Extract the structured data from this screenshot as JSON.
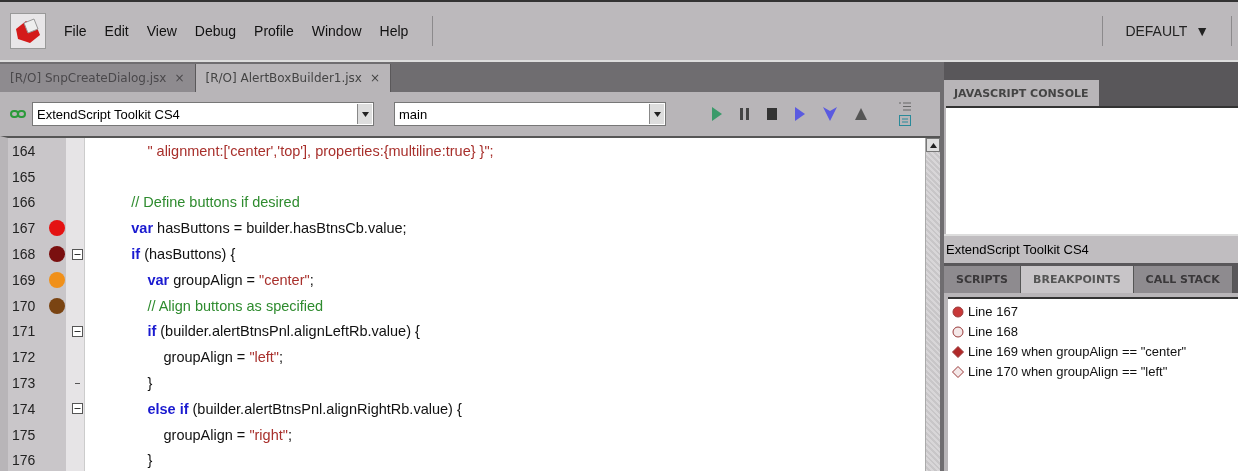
{
  "menu_bar": {
    "items": [
      "File",
      "Edit",
      "View",
      "Debug",
      "Profile",
      "Window",
      "Help"
    ],
    "workspace": "DEFAULT",
    "workspace_caret": "▼"
  },
  "document_tabs": [
    {
      "label": "[R/O] SnpCreateDialog.jsx",
      "close": "×",
      "selected": false
    },
    {
      "label": "[R/O] AlertBoxBuilder1.jsx",
      "close": "×",
      "selected": true
    }
  ],
  "toolbar": {
    "target": "ExtendScript Toolkit CS4",
    "function": "main"
  },
  "editor": {
    "lines": [
      {
        "number": "164",
        "tokens": [
          {
            "kind": "string",
            "text": "              \" alignment:['center','top'], properties:{multiline:true} }\";"
          }
        ]
      },
      {
        "number": "165"
      },
      {
        "number": "166",
        "tokens": [
          {
            "kind": "comment",
            "text": "          // Define buttons if desired"
          }
        ]
      },
      {
        "number": "167",
        "breakpoint": {
          "conditional": false,
          "enabled": true
        },
        "tokens": [
          {
            "kind": "keyword",
            "text": "          var"
          },
          {
            "kind": "plain",
            "text": " hasButtons = builder.hasBtnsCb.value;"
          }
        ]
      },
      {
        "number": "168",
        "breakpoint": {
          "conditional": false,
          "enabled": false
        },
        "collapse_box": true,
        "tokens": [
          {
            "kind": "keyword",
            "text": "          if"
          },
          {
            "kind": "plain",
            "text": " (hasButtons) {"
          }
        ]
      },
      {
        "number": "169",
        "breakpoint": {
          "conditional": true,
          "enabled": true
        },
        "tokens": [
          {
            "kind": "keyword",
            "text": "              var"
          },
          {
            "kind": "plain",
            "text": " groupAlign = "
          },
          {
            "kind": "string",
            "text": "\"center\""
          },
          {
            "kind": "plain",
            "text": ";"
          }
        ]
      },
      {
        "number": "170",
        "breakpoint": {
          "conditional": true,
          "enabled": false
        },
        "tokens": [
          {
            "kind": "comment",
            "text": "              // Align buttons as specified"
          }
        ]
      },
      {
        "number": "171",
        "collapse_box": true,
        "tokens": [
          {
            "kind": "keyword",
            "text": "              if"
          },
          {
            "kind": "plain",
            "text": " (builder.alertBtnsPnl.alignLeftRb.value) {"
          }
        ]
      },
      {
        "number": "172",
        "tokens": [
          {
            "kind": "plain",
            "text": "                  groupAlign = "
          },
          {
            "kind": "string",
            "text": "\"left\""
          },
          {
            "kind": "plain",
            "text": ";"
          }
        ]
      },
      {
        "number": "173",
        "block_end": true,
        "tokens": [
          {
            "kind": "plain",
            "text": "              }"
          }
        ]
      },
      {
        "number": "174",
        "collapse_box": true,
        "tokens": [
          {
            "kind": "keyword",
            "text": "              else if"
          },
          {
            "kind": "plain",
            "text": " (builder.alertBtnsPnl.alignRightRb.value) {"
          }
        ]
      },
      {
        "number": "175",
        "tokens": [
          {
            "kind": "plain",
            "text": "                  groupAlign = "
          },
          {
            "kind": "string",
            "text": "\"right\""
          },
          {
            "kind": "plain",
            "text": ";"
          }
        ]
      },
      {
        "number": "176",
        "tokens": [
          {
            "kind": "plain",
            "text": "              }"
          }
        ]
      }
    ]
  },
  "console_panel": {
    "tab": "JAVASCRIPT CONSOLE",
    "target": "ExtendScript Toolkit CS4"
  },
  "debug_panel": {
    "tabs": [
      {
        "label": "SCRIPTS",
        "selected": false
      },
      {
        "label": "BREAKPOINTS",
        "selected": true
      },
      {
        "label": "CALL STACK",
        "selected": false
      }
    ],
    "breakpoints": [
      {
        "kind": "circle",
        "enabled": true,
        "label": "Line 167"
      },
      {
        "kind": "circle",
        "enabled": false,
        "label": "Line 168"
      },
      {
        "kind": "diamond",
        "enabled": true,
        "label": "Line 169 when groupAlign == \"center\""
      },
      {
        "kind": "diamond",
        "enabled": false,
        "label": "Line 170 when groupAlign == \"left\""
      }
    ]
  }
}
